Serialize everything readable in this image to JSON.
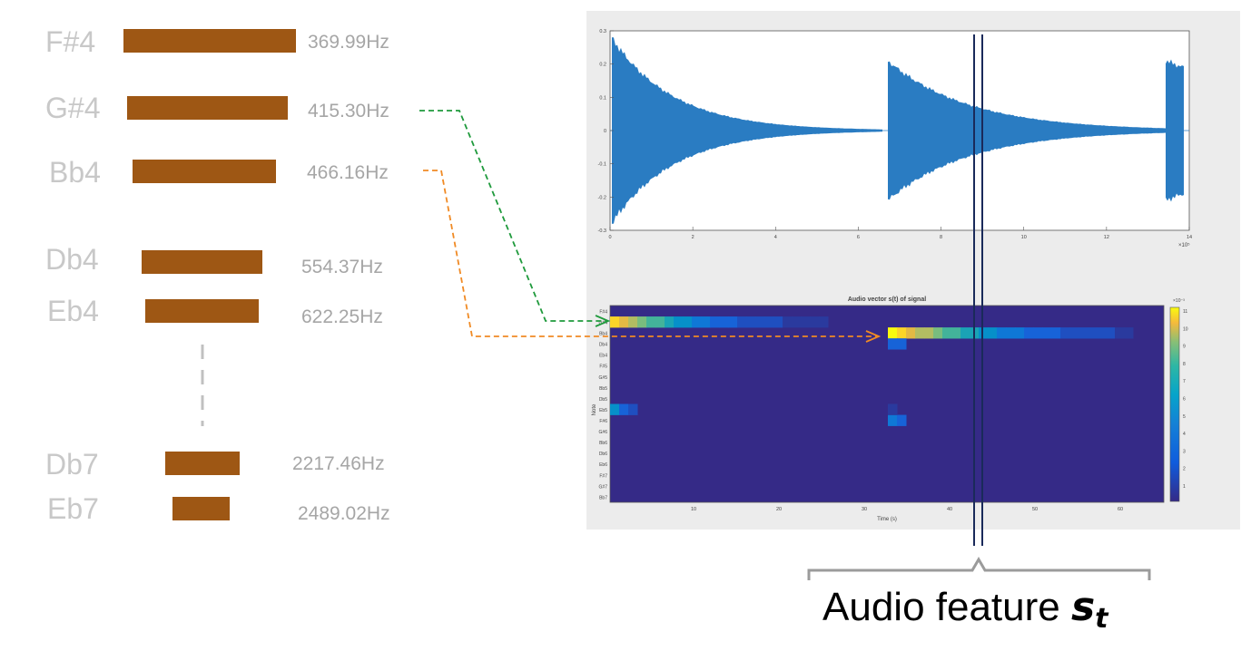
{
  "notes": [
    {
      "note": "F#4",
      "freq": "369.99Hz",
      "bar": 1.0
    },
    {
      "note": "G#4",
      "freq": "415.30Hz",
      "bar": 0.93
    },
    {
      "note": "Bb4",
      "freq": "466.16Hz",
      "bar": 0.83
    },
    {
      "note": "Db4",
      "freq": "554.37Hz",
      "bar": 0.7
    },
    {
      "note": "Eb4",
      "freq": "622.25Hz",
      "bar": 0.66
    },
    {
      "note": "Db7",
      "freq": "2217.46Hz",
      "bar": 0.43
    },
    {
      "note": "Eb7",
      "freq": "2489.02Hz",
      "bar": 0.33
    }
  ],
  "colors": {
    "bar": "#9e5714",
    "green_link": "#1f9a3c",
    "orange_link": "#f08a24",
    "marker": "#1a2a5a",
    "waveform": "#2a7cc2"
  },
  "waveform": {
    "y_ticks": [
      "0.3",
      "0.2",
      "0.1",
      "0",
      "-0.1",
      "-0.2",
      "-0.3"
    ],
    "x_ticks": [
      "0",
      "2",
      "4",
      "6",
      "8",
      "10",
      "12",
      "14"
    ],
    "x_exponent": "×10⁵"
  },
  "heatmap": {
    "title": "Audio vector s(t) of signal",
    "ylabel": "Note",
    "xlabel": "Time (s)",
    "rows": [
      "F#4",
      "G#4",
      "Bb4",
      "Db4",
      "Eb4",
      "F#5",
      "G#5",
      "Bb5",
      "Db5",
      "Eb5",
      "F#6",
      "G#6",
      "Bb6",
      "Db6",
      "Eb6",
      "F#7",
      "G#7",
      "Bb7"
    ],
    "x_ticks": [
      "10",
      "20",
      "30",
      "40",
      "50",
      "60"
    ],
    "colorbar_ticks": [
      "11",
      "10",
      "9",
      "8",
      "7",
      "6",
      "5",
      "4",
      "3",
      "2",
      "1"
    ],
    "colorbar_exponent": "×10⁻³"
  },
  "caption": {
    "text": "Audio feature ",
    "symbol": "s",
    "subscript": "t"
  }
}
